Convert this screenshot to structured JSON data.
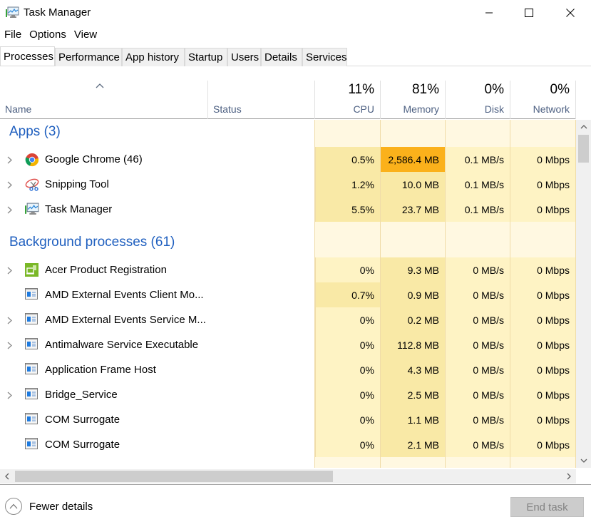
{
  "window": {
    "title": "Task Manager",
    "controls": {
      "minimize": "minimize",
      "maximize": "maximize",
      "close": "close"
    }
  },
  "menu": [
    "File",
    "Options",
    "View"
  ],
  "tabs": [
    {
      "label": "Processes",
      "active": true
    },
    {
      "label": "Performance",
      "active": false
    },
    {
      "label": "App history",
      "active": false
    },
    {
      "label": "Startup",
      "active": false
    },
    {
      "label": "Users",
      "active": false
    },
    {
      "label": "Details",
      "active": false
    },
    {
      "label": "Services",
      "active": false
    }
  ],
  "columns": {
    "name": "Name",
    "status": "Status",
    "cpu": {
      "label": "CPU",
      "total": "11%"
    },
    "memory": {
      "label": "Memory",
      "total": "81%"
    },
    "disk": {
      "label": "Disk",
      "total": "0%"
    },
    "network": {
      "label": "Network",
      "total": "0%"
    }
  },
  "colors": {
    "heat_light": "#fff8e1",
    "heat_low": "#fef3c4",
    "heat_mid": "#f9e9a6",
    "heat_high": "#fbb11b",
    "group_title": "#1f5fbf",
    "header_label": "#4d6082"
  },
  "groups": [
    {
      "title": "Apps (3)",
      "rows": [
        {
          "name": "Google Chrome (46)",
          "icon": "chrome-icon",
          "expandable": true,
          "status": "",
          "cpu": "0.5%",
          "memory": "2,586.4 MB",
          "disk": "0.1 MB/s",
          "network": "0 Mbps",
          "mem_heat": "high",
          "cpu_heat": "mid"
        },
        {
          "name": "Snipping Tool",
          "icon": "snipping-tool-icon",
          "expandable": true,
          "status": "",
          "cpu": "1.2%",
          "memory": "10.0 MB",
          "disk": "0.1 MB/s",
          "network": "0 Mbps",
          "mem_heat": "mid",
          "cpu_heat": "mid"
        },
        {
          "name": "Task Manager",
          "icon": "task-manager-icon",
          "expandable": true,
          "status": "",
          "cpu": "5.5%",
          "memory": "23.7 MB",
          "disk": "0.1 MB/s",
          "network": "0 Mbps",
          "mem_heat": "mid",
          "cpu_heat": "mid"
        }
      ]
    },
    {
      "title": "Background processes (61)",
      "rows": [
        {
          "name": "Acer Product Registration",
          "icon": "acer-registration-icon",
          "expandable": true,
          "status": "",
          "cpu": "0%",
          "memory": "9.3 MB",
          "disk": "0 MB/s",
          "network": "0 Mbps",
          "mem_heat": "mid",
          "cpu_heat": "low"
        },
        {
          "name": "AMD External Events Client Mo...",
          "icon": "window-process-icon",
          "expandable": false,
          "status": "",
          "cpu": "0.7%",
          "memory": "0.9 MB",
          "disk": "0 MB/s",
          "network": "0 Mbps",
          "mem_heat": "mid",
          "cpu_heat": "mid"
        },
        {
          "name": "AMD External Events Service M...",
          "icon": "window-process-icon",
          "expandable": true,
          "status": "",
          "cpu": "0%",
          "memory": "0.2 MB",
          "disk": "0 MB/s",
          "network": "0 Mbps",
          "mem_heat": "mid",
          "cpu_heat": "low"
        },
        {
          "name": "Antimalware Service Executable",
          "icon": "window-process-icon",
          "expandable": true,
          "status": "",
          "cpu": "0%",
          "memory": "112.8 MB",
          "disk": "0 MB/s",
          "network": "0 Mbps",
          "mem_heat": "mid",
          "cpu_heat": "low"
        },
        {
          "name": "Application Frame Host",
          "icon": "window-process-icon",
          "expandable": false,
          "status": "",
          "cpu": "0%",
          "memory": "4.3 MB",
          "disk": "0 MB/s",
          "network": "0 Mbps",
          "mem_heat": "mid",
          "cpu_heat": "low"
        },
        {
          "name": "Bridge_Service",
          "icon": "window-process-icon",
          "expandable": true,
          "status": "",
          "cpu": "0%",
          "memory": "2.5 MB",
          "disk": "0 MB/s",
          "network": "0 Mbps",
          "mem_heat": "mid",
          "cpu_heat": "low"
        },
        {
          "name": "COM Surrogate",
          "icon": "window-process-icon",
          "expandable": false,
          "status": "",
          "cpu": "0%",
          "memory": "1.1 MB",
          "disk": "0 MB/s",
          "network": "0 Mbps",
          "mem_heat": "mid",
          "cpu_heat": "low"
        },
        {
          "name": "COM Surrogate",
          "icon": "window-process-icon",
          "expandable": false,
          "status": "",
          "cpu": "0%",
          "memory": "2.1 MB",
          "disk": "0 MB/s",
          "network": "0 Mbps",
          "mem_heat": "mid",
          "cpu_heat": "low"
        }
      ]
    }
  ],
  "footer": {
    "fewer_details": "Fewer details",
    "end_task": "End task",
    "end_task_enabled": false
  }
}
